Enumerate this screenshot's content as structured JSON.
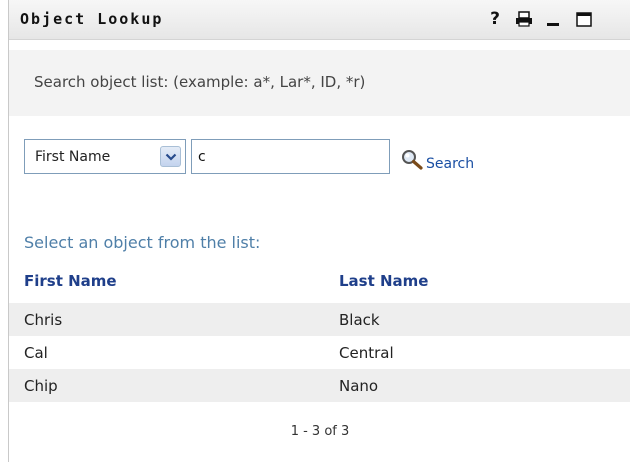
{
  "window": {
    "title": "Object Lookup",
    "controls": {
      "help": "?",
      "print_icon": "printer-icon",
      "minimize_icon": "minimize-icon",
      "maximize_icon": "maximize-icon"
    }
  },
  "hint": "Search object list: (example: a*, Lar*, ID, *r)",
  "search": {
    "field_select": "First Name",
    "value": "c",
    "button_label": "Search",
    "button_icon": "magnifier-icon"
  },
  "results": {
    "prompt": "Select an object from the list:",
    "columns": [
      "First Name",
      "Last Name"
    ],
    "rows": [
      {
        "first": "Chris",
        "last": "Black"
      },
      {
        "first": "Cal",
        "last": "Central"
      },
      {
        "first": "Chip",
        "last": "Nano"
      }
    ],
    "pager": "1 - 3 of 3"
  },
  "colors": {
    "link": "#1a4fa3",
    "header": "#1f3f8a",
    "prompt": "#4f7fa8",
    "row_shade": "#eeeeee"
  }
}
